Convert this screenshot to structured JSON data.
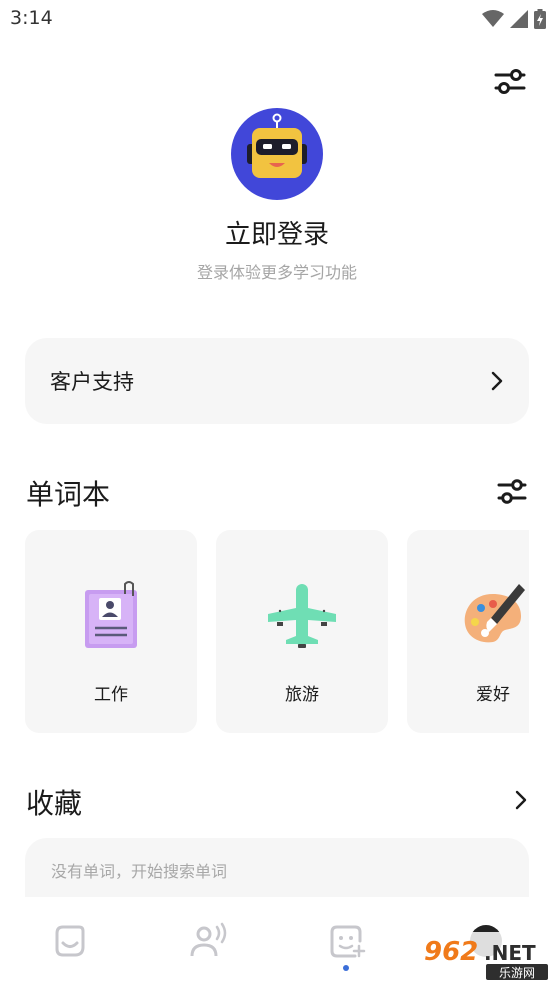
{
  "status_bar": {
    "time": "3:14",
    "wifi_icon": "wifi-icon",
    "signal_icon": "signal-icon",
    "battery_icon": "battery-charging-icon"
  },
  "header": {
    "settings_icon": "sliders-icon"
  },
  "profile": {
    "avatar_icon": "robot-avatar-icon",
    "login_title": "立即登录",
    "login_subtitle": "登录体验更多学习功能"
  },
  "support": {
    "label": "客户支持"
  },
  "wordbook": {
    "title": "单词本",
    "cards": [
      {
        "label": "工作",
        "icon": "id-card-icon"
      },
      {
        "label": "旅游",
        "icon": "airplane-icon"
      },
      {
        "label": "爱好",
        "icon": "palette-icon"
      }
    ]
  },
  "favorites": {
    "title": "收藏",
    "empty_text": "没有单词，开始搜索单词"
  },
  "tabbar": {
    "tabs": [
      {
        "icon": "home-face-icon"
      },
      {
        "icon": "speaking-icon"
      },
      {
        "icon": "wordbook-icon",
        "active": true
      },
      {
        "icon": "profile-icon"
      }
    ]
  },
  "watermark": {
    "text": "962.NET",
    "subtext": "乐游网"
  },
  "colors": {
    "accent": "#3b6ed8",
    "avatar_bg": "#4147d9",
    "card_bg": "#f6f6f6",
    "muted_text": "#a5a5a5"
  }
}
